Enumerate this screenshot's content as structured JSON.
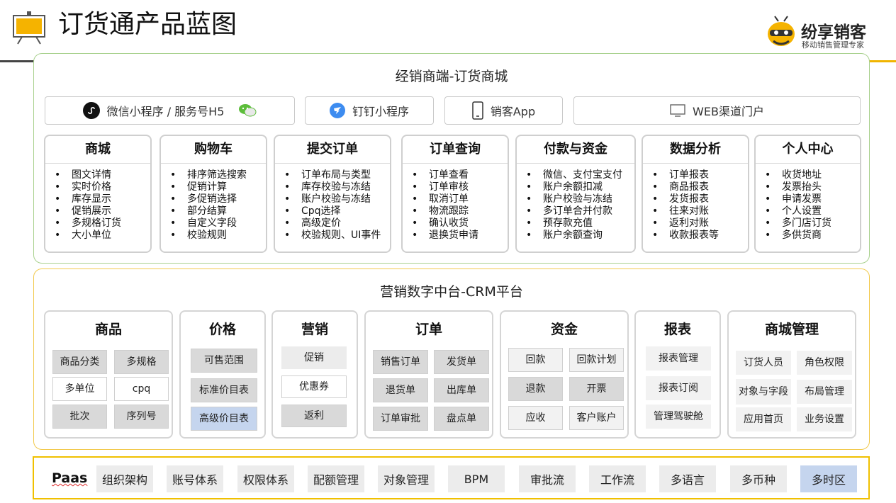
{
  "header": {
    "title": "订货通产品蓝图"
  },
  "brand": {
    "name": "纷享销客",
    "subtitle": "移动销售管理专家"
  },
  "dealer": {
    "title": "经销商端-订货商城",
    "channels": [
      {
        "label": "微信小程序 / 服务号H5"
      },
      {
        "label": "钉钉小程序"
      },
      {
        "label": "销客App"
      },
      {
        "label": "WEB渠道门户"
      }
    ],
    "cards": [
      {
        "title": "商城",
        "items": [
          "图文详情",
          "实时价格",
          "库存显示",
          "促销展示",
          "多规格订货",
          "大小单位"
        ]
      },
      {
        "title": "购物车",
        "items": [
          "排序筛选搜索",
          "促销计算",
          "多促销选择",
          "部分结算",
          "自定义字段",
          "校验规则"
        ]
      },
      {
        "title": "提交订单",
        "items": [
          "订单布局与类型",
          "库存校验与冻结",
          "账户校验与冻结",
          "Cpq选择",
          "高级定价",
          "校验规则、UI事件"
        ]
      },
      {
        "title": "订单查询",
        "items": [
          "订单查看",
          "订单审核",
          "取消订单",
          "物流跟踪",
          "确认收货",
          "退换货申请"
        ]
      },
      {
        "title": "付款与资金",
        "items": [
          "微信、支付宝支付",
          "账户余额扣减",
          "账户校验与冻结",
          "多订单合并付款",
          "预存款充值",
          "账户余额查询"
        ]
      },
      {
        "title": "数据分析",
        "items": [
          "订单报表",
          "商品报表",
          "发货报表",
          "往来对账",
          "返利对账",
          "收款报表等"
        ]
      },
      {
        "title": "个人中心",
        "items": [
          "收货地址",
          "发票抬头",
          "申请发票",
          "个人设置",
          "多门店订货",
          "多供货商"
        ]
      }
    ]
  },
  "crm": {
    "title": "营销数字中台-CRM平台",
    "modules": [
      {
        "title": "商品",
        "chips": [
          "商品分类",
          "多规格",
          "多单位",
          "cpq",
          "批次",
          "序列号"
        ]
      },
      {
        "title": "价格",
        "chips": [
          "可售范围",
          "标准价目表",
          "高级价目表"
        ]
      },
      {
        "title": "营销",
        "chips": [
          "促销",
          "优惠券",
          "返利"
        ]
      },
      {
        "title": "订单",
        "chips": [
          "销售订单",
          "发货单",
          "退货单",
          "出库单",
          "订单审批",
          "盘点单"
        ]
      },
      {
        "title": "资金",
        "chips": [
          "回款",
          "回款计划",
          "退款",
          "开票",
          "应收",
          "客户账户"
        ]
      },
      {
        "title": "报表",
        "chips": [
          "报表管理",
          "报表订阅",
          "管理驾驶舱"
        ]
      },
      {
        "title": "商城管理",
        "chips": [
          "订货人员",
          "角色权限",
          "对象与字段",
          "布局管理",
          "应用首页",
          "业务设置"
        ]
      }
    ]
  },
  "paas": {
    "label": "Paas",
    "items": [
      "组织架构",
      "账号体系",
      "权限体系",
      "配额管理",
      "对象管理",
      "BPM",
      "审批流",
      "工作流",
      "多语言",
      "多币种",
      "多时区"
    ]
  },
  "colors": {
    "dealer_border": "#a9d18e",
    "crm_border": "#f2c94c",
    "paas_border": "#f0c000",
    "highlight_chip": "#c5d5ee",
    "header_icon": "#f5b300"
  }
}
